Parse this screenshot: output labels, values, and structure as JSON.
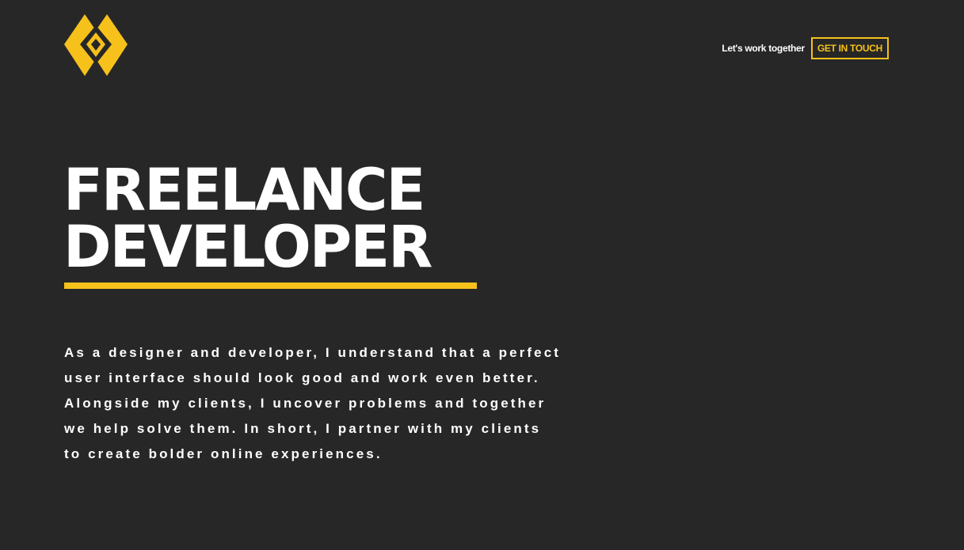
{
  "colors": {
    "background": "#272727",
    "accent": "#f6c11b",
    "text": "#ffffff"
  },
  "header": {
    "logo_icon": "diamond-logo-icon",
    "cta_prompt": "Let's work together",
    "cta_button_label": "GET IN TOUCH"
  },
  "hero": {
    "title_lines": [
      "FREELANCE",
      "DEVELOPER"
    ],
    "intro_lines": [
      "As a designer and developer, I understand that a perfect",
      "user interface should look good and work even better.",
      "Alongside my clients, I uncover problems and together",
      "we help solve them. In short, I partner with my clients",
      "to create bolder online experiences."
    ]
  }
}
